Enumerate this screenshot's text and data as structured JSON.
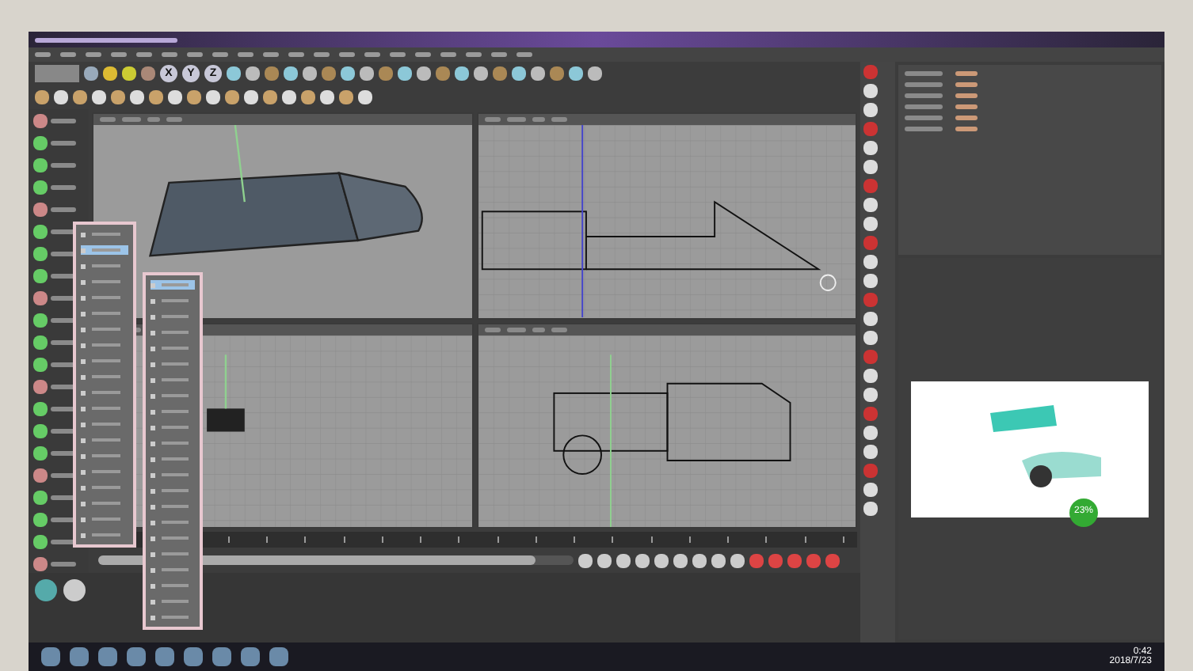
{
  "toolbar": {
    "axis_buttons": [
      {
        "label": "X"
      },
      {
        "label": "Y"
      },
      {
        "label": "Z"
      }
    ]
  },
  "floating_menus": [
    {
      "items": [
        {
          "selected": false
        },
        {
          "selected": true
        },
        {
          "selected": false
        },
        {
          "selected": false
        },
        {
          "selected": false
        },
        {
          "selected": false
        },
        {
          "selected": false
        },
        {
          "selected": false
        },
        {
          "selected": false
        },
        {
          "selected": false
        },
        {
          "selected": false
        },
        {
          "selected": false
        },
        {
          "selected": false
        },
        {
          "selected": false
        },
        {
          "selected": false
        },
        {
          "selected": false
        },
        {
          "selected": false
        },
        {
          "selected": false
        },
        {
          "selected": false
        },
        {
          "selected": false
        }
      ]
    },
    {
      "items": [
        {
          "selected": true
        },
        {
          "selected": false
        },
        {
          "selected": false
        },
        {
          "selected": false
        },
        {
          "selected": false
        },
        {
          "selected": false
        },
        {
          "selected": false
        },
        {
          "selected": false
        },
        {
          "selected": false
        },
        {
          "selected": false
        },
        {
          "selected": false
        },
        {
          "selected": false
        },
        {
          "selected": false
        },
        {
          "selected": false
        },
        {
          "selected": false
        },
        {
          "selected": false
        },
        {
          "selected": false
        },
        {
          "selected": false
        },
        {
          "selected": false
        },
        {
          "selected": false
        },
        {
          "selected": false
        },
        {
          "selected": false
        }
      ]
    }
  ],
  "timeline": {
    "level": 0.92
  },
  "render_preview": {
    "progress": "23%"
  },
  "taskbar": {
    "clock": "0:42",
    "date": "2018/7/23"
  }
}
